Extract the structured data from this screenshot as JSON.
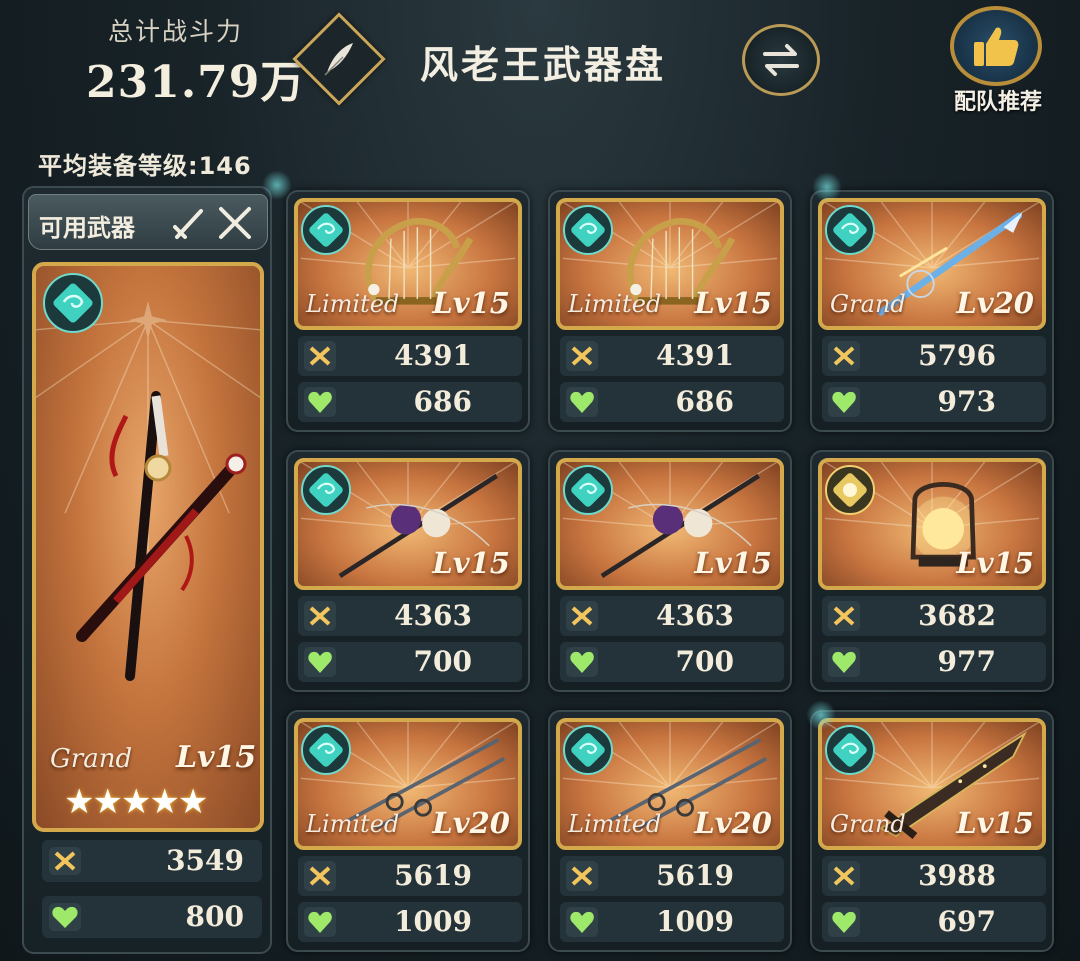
{
  "header": {
    "power_label": "总计战斗力",
    "power_value": "231.79万",
    "title": "风老王武器盘",
    "recommend_label": "配队推荐",
    "avg_level": "平均装备等级:146"
  },
  "sidebar": {
    "tab_label": "可用武器",
    "featured": {
      "element": "wind",
      "rarity": "Grand",
      "level": "Lv15",
      "stars": 5,
      "stars_text": "★★★★★",
      "attack": "3549",
      "hp": "800"
    }
  },
  "weapons": [
    {
      "element": "wind",
      "rarity": "Limited",
      "level": "Lv15",
      "attack": "4391",
      "hp": "686",
      "icon": "harp-weapon-icon"
    },
    {
      "element": "wind",
      "rarity": "Limited",
      "level": "Lv15",
      "attack": "4391",
      "hp": "686",
      "icon": "harp-weapon-icon"
    },
    {
      "element": "wind",
      "rarity": "Grand",
      "level": "Lv20",
      "attack": "5796",
      "hp": "973",
      "icon": "spear-weapon-icon"
    },
    {
      "element": "wind",
      "rarity": "",
      "level": "Lv15",
      "attack": "4363",
      "hp": "700",
      "icon": "orb-staff-weapon-icon"
    },
    {
      "element": "wind",
      "rarity": "",
      "level": "Lv15",
      "attack": "4363",
      "hp": "700",
      "icon": "orb-staff-weapon-icon"
    },
    {
      "element": "light",
      "rarity": "",
      "level": "Lv15",
      "attack": "3682",
      "hp": "977",
      "icon": "lantern-weapon-icon"
    },
    {
      "element": "wind",
      "rarity": "Limited",
      "level": "Lv20",
      "attack": "5619",
      "hp": "1009",
      "icon": "rapier-weapon-icon"
    },
    {
      "element": "wind",
      "rarity": "Limited",
      "level": "Lv20",
      "attack": "5619",
      "hp": "1009",
      "icon": "rapier-weapon-icon"
    },
    {
      "element": "wind",
      "rarity": "Grand",
      "level": "Lv15",
      "attack": "3988",
      "hp": "697",
      "icon": "greatsword-weapon-icon"
    }
  ],
  "colors": {
    "gold_frame": "#d3a94c",
    "card_bg": "#c87540",
    "wind_element": "#3fd2c0",
    "light_element": "#f0d070",
    "panel_bg": "#1d292e"
  }
}
